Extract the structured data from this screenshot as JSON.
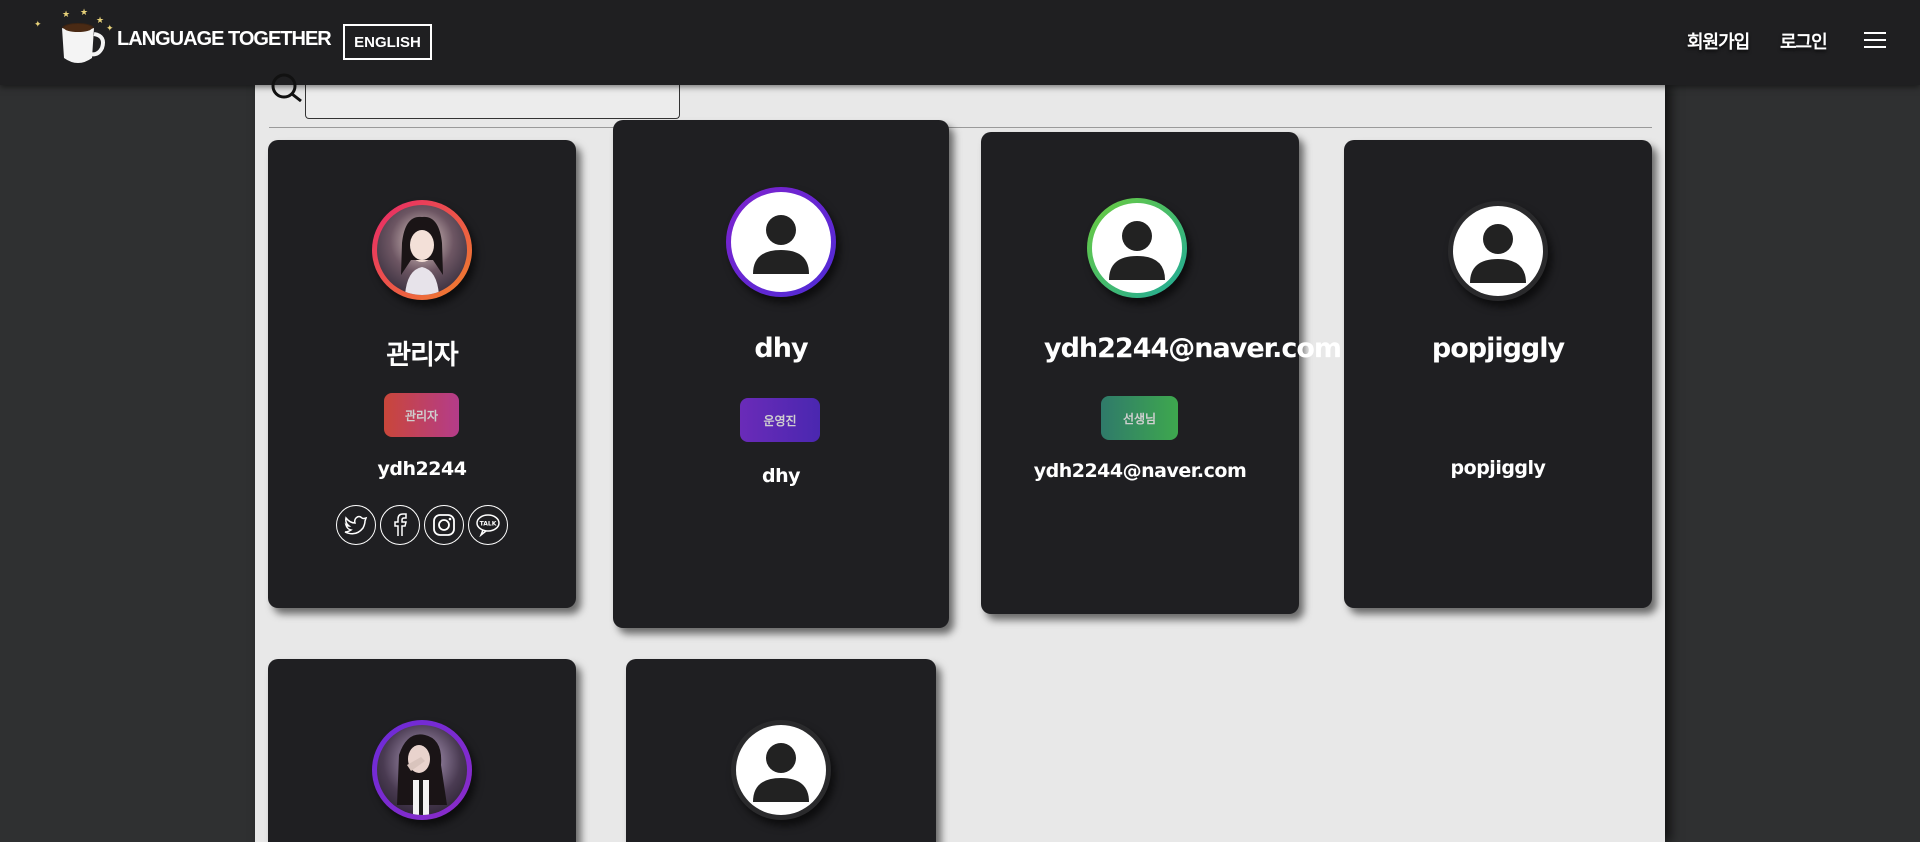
{
  "header": {
    "brand": "LANGUAGE TOGETHER",
    "language_button": "ENGLISH",
    "signup": "회원가입",
    "login": "로그인"
  },
  "cards": [
    {
      "name": "관리자",
      "badge": "관리자",
      "id": "ydh2244",
      "ring": "orange-red"
    },
    {
      "name": "dhy",
      "badge": "운영진",
      "id": "dhy",
      "ring": "purple"
    },
    {
      "name": "ydh2244@naver.com",
      "badge": "선생님",
      "id": "ydh2244@naver.com",
      "ring": "green"
    },
    {
      "name": "popjiggly",
      "id": "popjiggly",
      "ring": "none"
    }
  ],
  "icons": {
    "menu": "hamburger-icon",
    "search": "search-icon",
    "social": [
      "twitter-icon",
      "facebook-icon",
      "instagram-icon",
      "kakaotalk-icon"
    ]
  },
  "colors": {
    "header": "#1f1f21",
    "background": "#2f3031",
    "panel": "#e8e8e8",
    "card": "#1f1f22",
    "admin_badge": "#c9463a",
    "staff_badge": "#6a2bb8",
    "teacher_badge": "#2f9a6a"
  }
}
